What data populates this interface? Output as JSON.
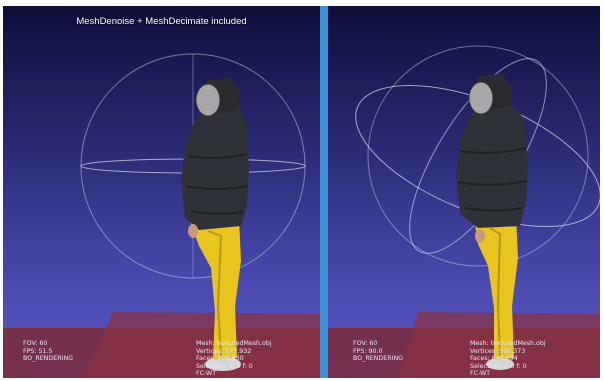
{
  "overlay": {
    "title": "MeshDenoise + MeshDecimate included"
  },
  "left_view": {
    "render_info": {
      "fov": "FOV: 60",
      "fps": "FPS:   51.5",
      "mode": "BO_RENDERING"
    },
    "mesh_info": {
      "name": "Mesh: texturedMesh.obj",
      "vertices": "Vertices: 577,932",
      "faces": "Faces: 909,830",
      "selection": "Selection: v: 0 f: 0",
      "extra": "FC-WT"
    }
  },
  "right_view": {
    "render_info": {
      "fov": "FOV: 60",
      "fps": "FPS:   90.0",
      "mode": "BO_RENDERING"
    },
    "mesh_info": {
      "name": "Mesh: texturedMesh.obj",
      "vertices": "Vertices: 595,373",
      "faces": "Faces: 640,694",
      "selection": "Selection: v: 0 f: 0",
      "extra": "FC-WT"
    }
  },
  "colors": {
    "background_top": "#0e0e3a",
    "background_bottom": "#5a58c4",
    "floor": "#7a2a3a",
    "divider": "#3d8fd6",
    "jacket": "#2f3138",
    "pants": "#e8c51f"
  }
}
